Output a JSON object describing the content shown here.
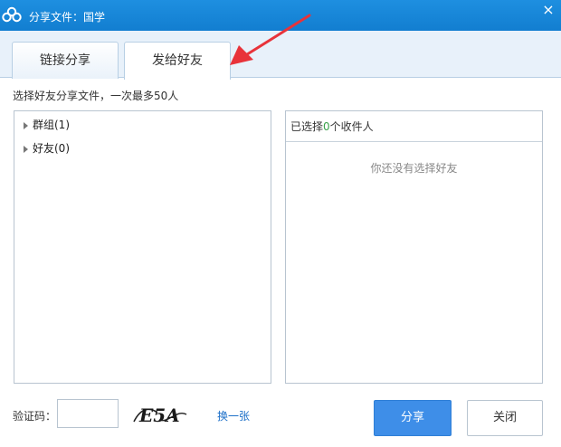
{
  "window": {
    "title": "分享文件：国学",
    "close_glyph": "×",
    "logo_icon": "cloud-logo-icon"
  },
  "tabs": [
    {
      "label": "链接分享",
      "active": false
    },
    {
      "label": "发给好友",
      "active": true
    }
  ],
  "hint": "选择好友分享文件，一次最多50人",
  "tree": [
    {
      "label": "群组(1)"
    },
    {
      "label": "好友(0)"
    }
  ],
  "selected": {
    "prefix": "已选择",
    "count": "0",
    "suffix": "个收件人",
    "empty_text": "你还没有选择好友"
  },
  "captcha": {
    "label": "验证码：",
    "value": "",
    "image_text": "E5A",
    "refresh_label": "换一张"
  },
  "buttons": {
    "share_label": "分享",
    "close_label": "关闭"
  },
  "colors": {
    "titlebar": "#1a87da",
    "accent": "#3e8ee8",
    "count_green": "#3aa14a",
    "arrow_red": "#e8333a"
  }
}
